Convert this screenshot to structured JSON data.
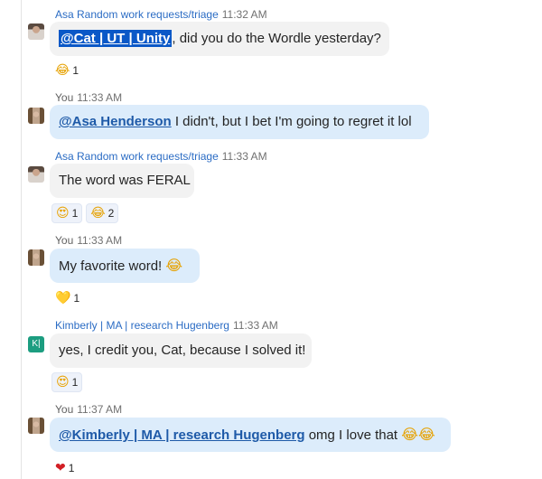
{
  "messages": [
    {
      "sender": "Asa Random work requests/triage",
      "time": "11:32 AM",
      "mention": "@Cat | UT | Unity",
      "text": ", did you do the Wordle yesterday?",
      "reactions": [
        {
          "emoji": "😂",
          "count": "1"
        }
      ]
    },
    {
      "sender": "You",
      "time": "11:33 AM",
      "mention": "@Asa Henderson",
      "text": " I didn't, but I bet I'm going to regret it lol"
    },
    {
      "sender": "Asa Random work requests/triage",
      "time": "11:33 AM",
      "text": "The word was FERAL",
      "reactions": [
        {
          "emoji": "😍",
          "count": "1"
        },
        {
          "emoji": "😂",
          "count": "2"
        }
      ]
    },
    {
      "sender": "You",
      "time": "11:33 AM",
      "text": "My favorite word! ",
      "inline_emoji": "😂",
      "reactions": [
        {
          "emoji": "💛",
          "count": "1"
        }
      ]
    },
    {
      "sender": "Kimberly | MA | research Hugenberg",
      "time": "11:33 AM",
      "avatar_initials": "K|",
      "text": "yes, I credit you, Cat, because I solved it!",
      "reactions": [
        {
          "emoji": "😍",
          "count": "1"
        }
      ]
    },
    {
      "sender": "You",
      "time": "11:37 AM",
      "mention": "@Kimberly | MA | research Hugenberg",
      "text": " omg I love that ",
      "inline_emoji": "😂😂",
      "reactions": [
        {
          "emoji": "❤",
          "count": "1"
        }
      ]
    }
  ],
  "colors": {
    "sender_link": "#2b6cc4",
    "mine_bubble": "#dcecfb",
    "their_bubble": "#f2f2f2",
    "mention_selected_bg": "#0a58c7"
  }
}
